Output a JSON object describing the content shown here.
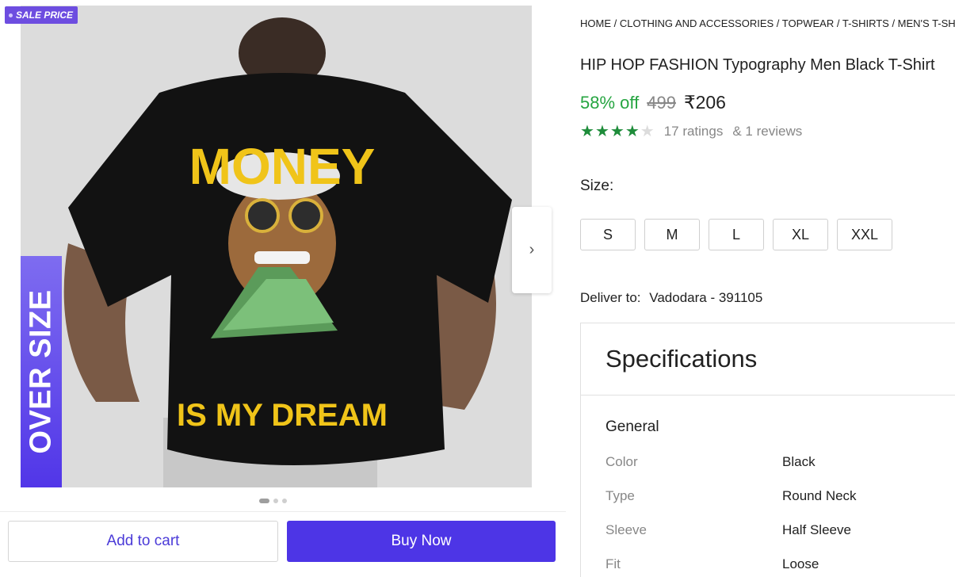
{
  "gallery": {
    "sale_badge": "SALE PRICE",
    "oversize_label": "OVER SIZE",
    "print_top": "MONEY",
    "print_bottom": "IS MY DREAM",
    "next_icon": "chevron-right",
    "dots_total": 3,
    "dots_active": 1
  },
  "actions": {
    "add_to_cart": "Add to cart",
    "buy_now": "Buy Now"
  },
  "product": {
    "breadcrumb": "HOME / CLOTHING AND ACCESSORIES / TOPWEAR / T-SHIRTS / MEN'S T-SHIR",
    "title": "HIP HOP FASHION Typography Men Black T-Shirt",
    "discount": "58% off",
    "mrp": "499",
    "price": "₹206",
    "rating_value": 4,
    "rating_max": 5,
    "ratings_text": "17 ratings",
    "reviews_text": "& 1 reviews"
  },
  "size": {
    "label": "Size:",
    "options": [
      "S",
      "M",
      "L",
      "XL",
      "XXL"
    ]
  },
  "delivery": {
    "label": "Deliver to:",
    "location": "Vadodara - 391105"
  },
  "specs": {
    "heading": "Specifications",
    "group": "General",
    "rows": [
      {
        "key": "Color",
        "value": "Black"
      },
      {
        "key": "Type",
        "value": "Round Neck"
      },
      {
        "key": "Sleeve",
        "value": "Half Sleeve"
      },
      {
        "key": "Fit",
        "value": "Loose"
      }
    ]
  },
  "colors": {
    "accent": "#4d35e6",
    "discount_green": "#26a541",
    "star_green": "#1e8c3a",
    "badge_purple": "#6d4de0"
  }
}
